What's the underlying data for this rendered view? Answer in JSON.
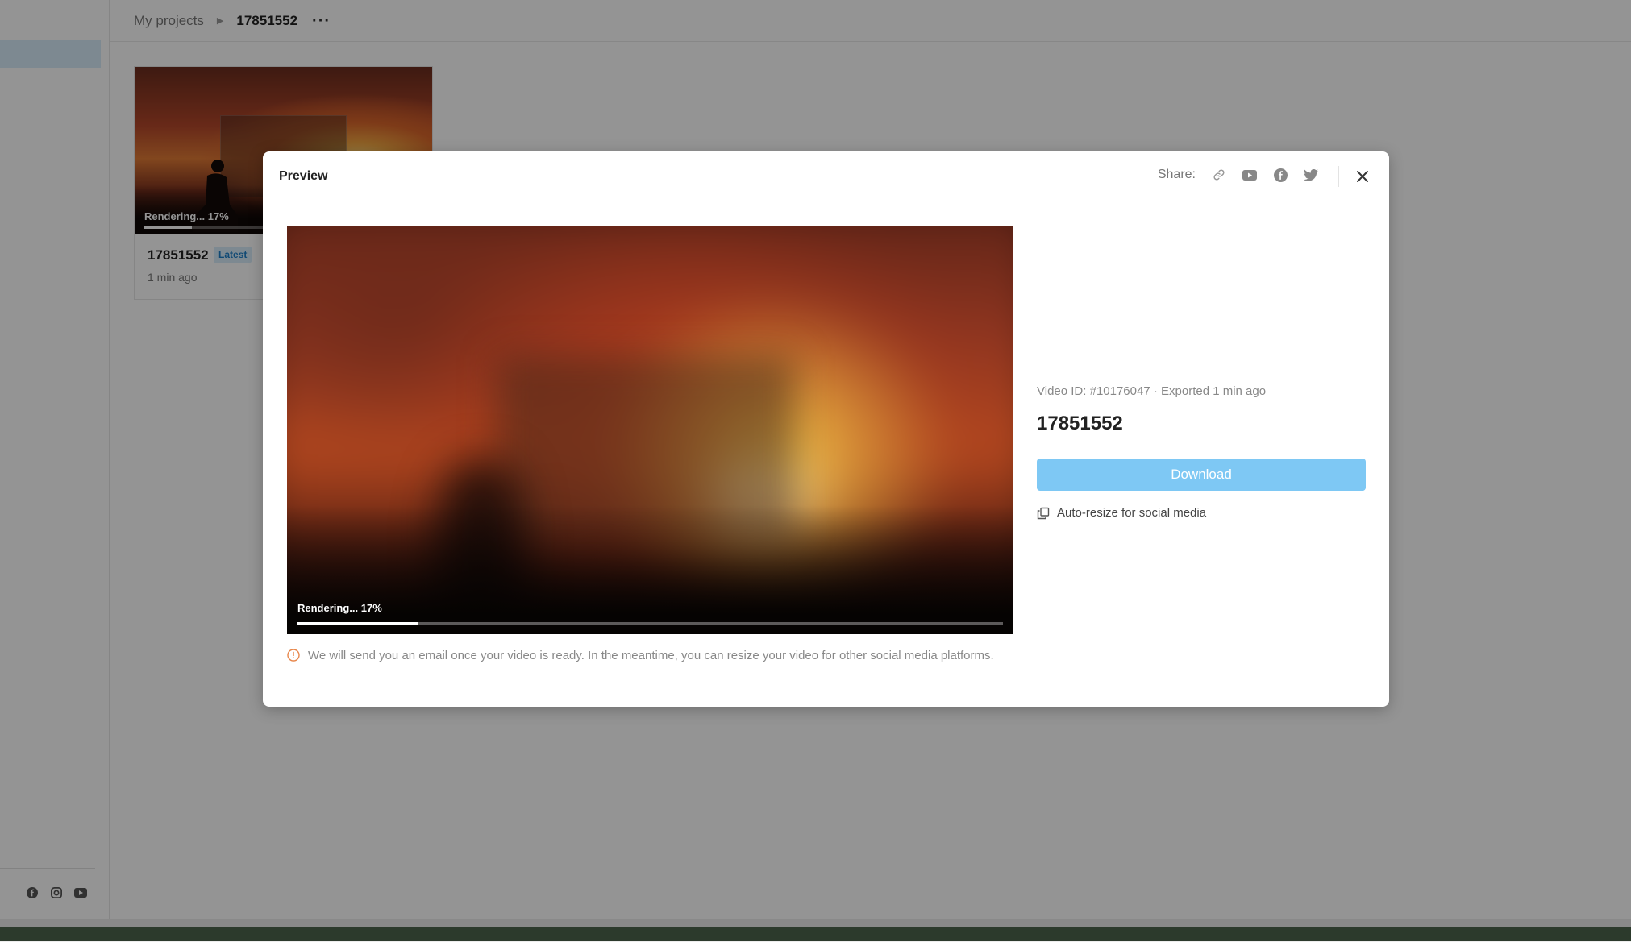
{
  "breadcrumb": {
    "parent": "My projects",
    "current": "17851552",
    "more": "···"
  },
  "card": {
    "rendering_label": "Rendering... 17%",
    "progress": 0.17,
    "title": "17851552",
    "badge": "Latest",
    "time": "1 min ago"
  },
  "sidebar": {
    "social_icons": [
      "facebook-icon",
      "instagram-icon",
      "youtube-icon"
    ]
  },
  "modal": {
    "title": "Preview",
    "share_label": "Share:",
    "share_icons": [
      "link-icon",
      "youtube-icon",
      "facebook-icon",
      "twitter-icon"
    ],
    "video": {
      "rendering_label": "Rendering... 17%",
      "progress": 0.17
    },
    "info_text": "We will send you an email once your video is ready. In the meantime, you can resize your video for other social media platforms.",
    "meta": "Video ID: #10176047 · Exported 1 min ago",
    "video_title": "17851552",
    "download_label": "Download",
    "autoresize_label": "Auto-resize for social media"
  },
  "colors": {
    "accent": "#7ec8f4",
    "badge_bg": "#d7ecfa",
    "badge_text": "#1d7fc9",
    "info_icon": "#e8864a"
  }
}
